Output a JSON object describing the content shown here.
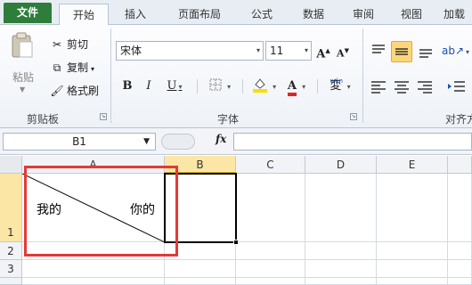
{
  "tabs": [
    "文件",
    "开始",
    "插入",
    "页面布局",
    "公式",
    "数据",
    "审阅",
    "视图",
    "加载"
  ],
  "clipboard": {
    "paste_label": "粘贴",
    "cut_label": "剪切",
    "copy_label": "复制",
    "format_painter_label": "格式刷",
    "group_label": "剪贴板"
  },
  "font": {
    "name_value": "宋体",
    "size_value": "11",
    "bold": "B",
    "italic": "I",
    "underline": "U",
    "font_color_letter": "A",
    "grow": "A",
    "shrink": "A",
    "phonetic": "wén",
    "phonetic_char": "変",
    "group_label": "字体"
  },
  "align": {
    "group_label": "对齐方"
  },
  "formula_bar": {
    "name_box": "B1",
    "fx": "fx"
  },
  "columns": [
    "A",
    "B",
    "C",
    "D",
    "E"
  ],
  "rows": [
    "1",
    "2",
    "3"
  ],
  "cells": {
    "a1_left": "我的",
    "a1_right": "你的"
  },
  "colors": {
    "file_tab": "#2f7d3b",
    "selection_header": "#fbe6a5",
    "highlight_frame": "#e53935",
    "font_color_bar": "#e02424",
    "fill_color_bar": "#f5e100"
  },
  "icons": [
    "paste-icon",
    "cut-icon",
    "copy-icon",
    "format-painter-icon",
    "borders-icon",
    "fill-color-icon",
    "font-color-icon",
    "phonetic-icon",
    "align-top-icon",
    "align-middle-icon",
    "align-bottom-icon",
    "orientation-icon",
    "wrap-text-icon",
    "align-left-icon",
    "align-center-icon",
    "align-right-icon",
    "indent-icon",
    "fx-icon"
  ]
}
